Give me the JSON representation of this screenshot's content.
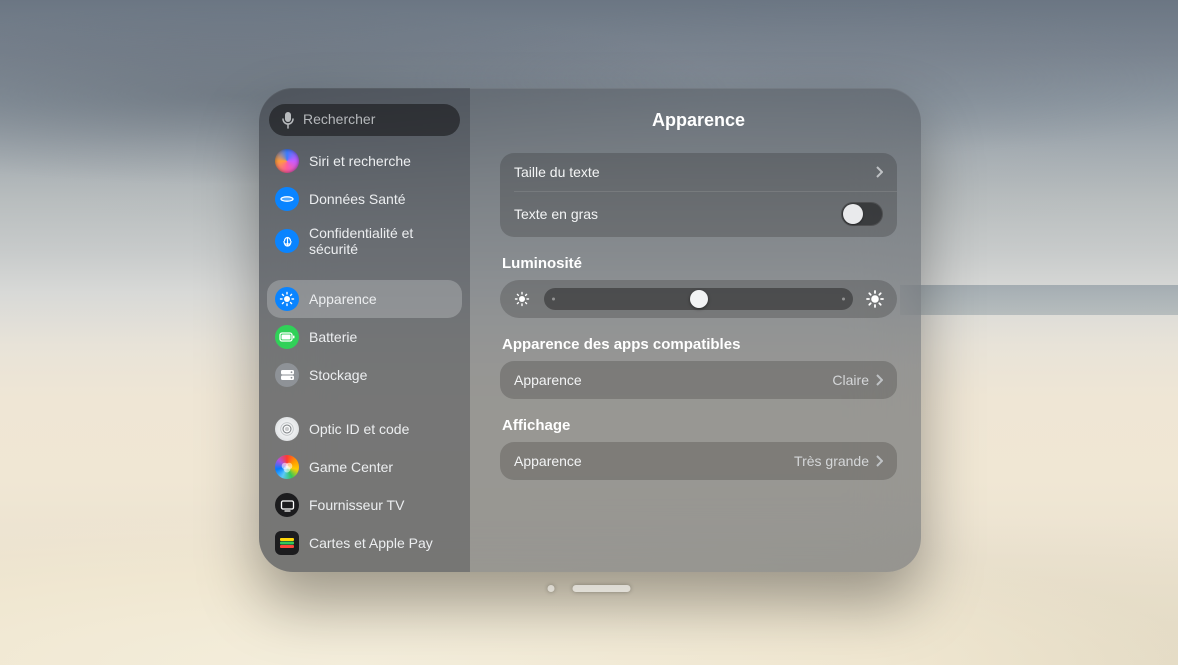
{
  "search": {
    "placeholder": "Rechercher"
  },
  "page_title": "Apparence",
  "sidebar": {
    "items": [
      {
        "label": "Siri et recherche"
      },
      {
        "label": "Données Santé"
      },
      {
        "label": "Confidentialité et sécurité"
      },
      {
        "label": "Apparence"
      },
      {
        "label": "Batterie"
      },
      {
        "label": "Stockage"
      },
      {
        "label": "Optic ID et code"
      },
      {
        "label": "Game Center"
      },
      {
        "label": "Fournisseur TV"
      },
      {
        "label": "Cartes et Apple Pay"
      }
    ]
  },
  "rows": {
    "text_size_label": "Taille du texte",
    "bold_text_label": "Texte en gras",
    "bold_text_on": false,
    "brightness_label": "Luminosité",
    "brightness_percent": 50,
    "compat_header": "Apparence des apps compatibles",
    "compat_label": "Apparence",
    "compat_value": "Claire",
    "display_header": "Affichage",
    "display_label": "Apparence",
    "display_value": "Très grande"
  },
  "colors": {
    "siri": "conic-gradient(#3a7cff,#c85cff,#ff5ca0,#ff9e3d,#3a7cff)",
    "health": "#0a84ff",
    "privacy": "#0a84ff",
    "appearance": "#0a84ff",
    "battery": "#30d158",
    "storage": "#8e9297",
    "optic": "#d9dbde",
    "gamecenter": "conic-gradient(#ff3b30,#ff9500,#ffcc00,#34c759,#5ac8fa,#af52de,#ff3b30)",
    "tv": "#1c1c1e",
    "wallet": "#1c1c1e"
  }
}
